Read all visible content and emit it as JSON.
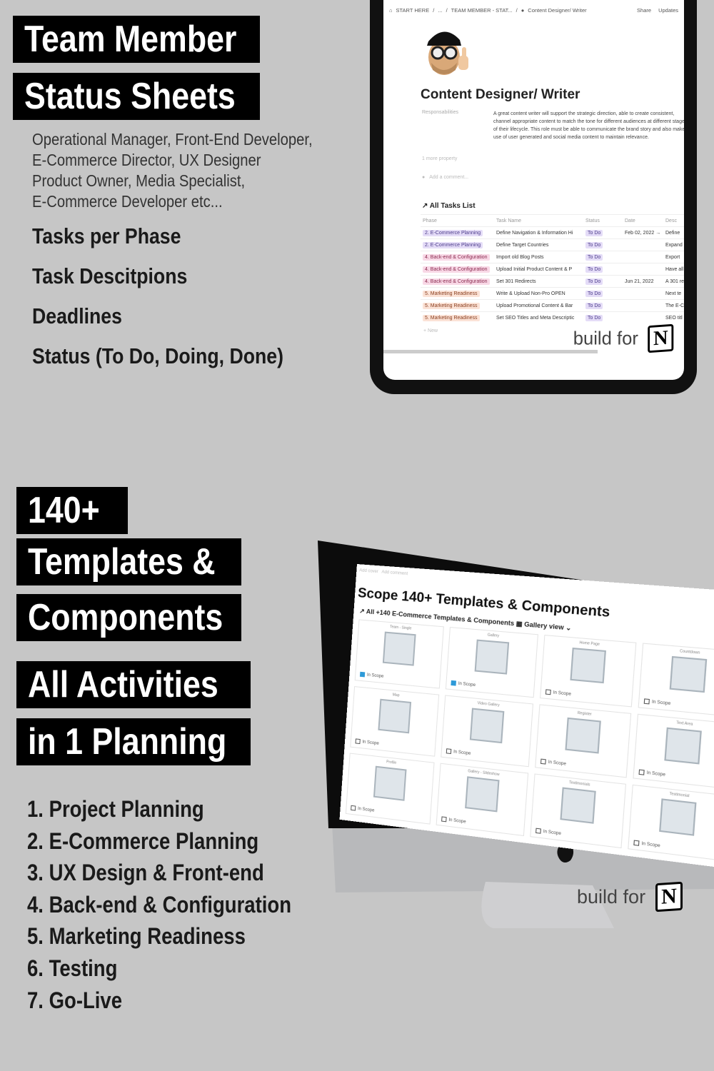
{
  "top": {
    "labels": [
      "Team Member",
      "Status Sheets"
    ],
    "roles": [
      "Operational Manager, Front-End Developer,",
      "E-Commerce Director, UX Designer",
      "Product Owner, Media Specialist,",
      "E-Commerce Developer etc..."
    ],
    "features": [
      "Tasks per Phase",
      "Task Descitpions",
      "Deadlines",
      "Status (To Do, Doing, Done)"
    ]
  },
  "tablet": {
    "breadcrumb": [
      "START HERE",
      "...",
      "TEAM MEMBER - STAT...",
      "Content Designer/ Writer"
    ],
    "share": "Share",
    "updates": "Updates",
    "title": "Content Designer/ Writer",
    "prop_key": "Responsabilities",
    "prop_value": "A great content writer will support the strategic direction, able to create consistent, channel appropriate content to match the tone for different audiences at different stages of their lifecycle. This role must be able to communicate the brand story and also make use of user generated and social media content to maintain relevance.",
    "more": "1 more property",
    "comment": "Add a comment...",
    "list_title": "All Tasks List",
    "columns": [
      "Phase",
      "Task Name",
      "Status",
      "Date",
      "Desc"
    ],
    "rows": [
      {
        "phase": "2. E-Commerce Planning",
        "p": "p2",
        "task": "Define Navigation & Information Hi",
        "status": "To Do",
        "date": "Feb 02, 2022 →",
        "desc": "Define"
      },
      {
        "phase": "2. E-Commerce Planning",
        "p": "p2",
        "task": "Define Target Countries",
        "status": "To Do",
        "date": "",
        "desc": "Expand"
      },
      {
        "phase": "4. Back-end & Configuration",
        "p": "p4",
        "task": "Import old Blog Posts",
        "status": "To Do",
        "date": "",
        "desc": "Export"
      },
      {
        "phase": "4. Back-end & Configuration",
        "p": "p4",
        "task": "Upload Initial Product Content & P",
        "status": "To Do",
        "date": "",
        "desc": "Have all"
      },
      {
        "phase": "4. Back-end & Configuration",
        "p": "p4",
        "task": "Set 301 Redirects",
        "status": "To Do",
        "date": "Jun 21, 2022",
        "desc": "A 301 re"
      },
      {
        "phase": "5. Marketing Readiness",
        "p": "p5",
        "task": "Write & Upload Non-Pro  OPEN",
        "status": "To Do",
        "date": "",
        "desc": "Next te"
      },
      {
        "phase": "5. Marketing Readiness",
        "p": "p5",
        "task": "Upload Promotional Content & Bar",
        "status": "To Do",
        "date": "",
        "desc": "The E-C"
      },
      {
        "phase": "5. Marketing Readiness",
        "p": "p5",
        "task": "Set SEO Titles and Meta Descriptic",
        "status": "To Do",
        "date": "",
        "desc": "SEO titl"
      }
    ],
    "new": "+ New"
  },
  "build_for": "build for",
  "notion_letter": "N",
  "bottom": {
    "labels": [
      "140+",
      "Templates &",
      "Components",
      "All Activities",
      "in 1 Planning"
    ],
    "phases": [
      "1. Project Planning",
      "2. E-Commerce Planning",
      "3. UX Design & Front-end",
      "4. Back-end & Configuration",
      "5. Marketing Readiness",
      "6. Testing",
      "7. Go-Live"
    ]
  },
  "imac": {
    "add_cover": "Add cover",
    "add_comment": "Add comment",
    "title": "Scope 140+ Templates & Components",
    "subtitle": "↗ All +140 E-Commerce Templates & Components   ▦ Gallery view ⌄",
    "scope_label": "In Scope",
    "cards": [
      {
        "name": "Team - Single",
        "in": true
      },
      {
        "name": "Gallery",
        "in": true
      },
      {
        "name": "Home Page",
        "in": false
      },
      {
        "name": "Countdown",
        "in": false
      },
      {
        "name": "Map",
        "in": false
      },
      {
        "name": "Video Gallery",
        "in": false
      },
      {
        "name": "Register",
        "in": false
      },
      {
        "name": "Text Area",
        "in": false
      },
      {
        "name": "Profile",
        "in": false
      },
      {
        "name": "Gallery - Slideshow",
        "in": false
      },
      {
        "name": "Testimonials",
        "in": false
      },
      {
        "name": "Testimonial",
        "in": false
      }
    ]
  }
}
